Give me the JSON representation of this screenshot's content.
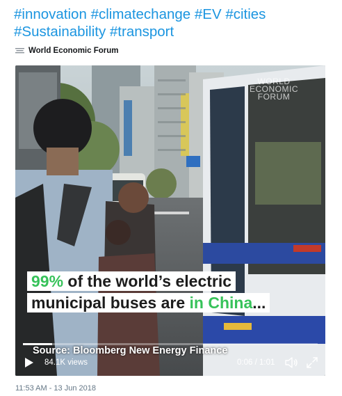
{
  "tweet": {
    "hashtags": [
      "#innovation",
      "#climatechange",
      "#EV",
      "#cities",
      "#Sustainability",
      "#transport"
    ],
    "source_name": "World Economic Forum",
    "source_icon": "wef-logo-icon",
    "timestamp": "11:53 AM - 13 Jun 2018",
    "link_color": "#1b95e0"
  },
  "video": {
    "watermark": "WORLD ECONOMIC FORUM",
    "caption_line1_highlight": "99%",
    "caption_line1_rest": " of the world’s electric",
    "caption_line2_rest": "municipal buses are ",
    "caption_line2_highlight": "in China",
    "caption_line2_end": "...",
    "highlight_color": "#37c25a",
    "caption_source": "Source: Bloomberg New Energy Finance",
    "views": "84.1K views",
    "current_time": "0:06",
    "duration": "1:01",
    "time_display": "0:06 / 1:01",
    "progress_fraction": 0.098,
    "controls": {
      "play_icon": "play-icon",
      "volume_icon": "volume-icon",
      "fullscreen_icon": "fullscreen-icon"
    }
  }
}
